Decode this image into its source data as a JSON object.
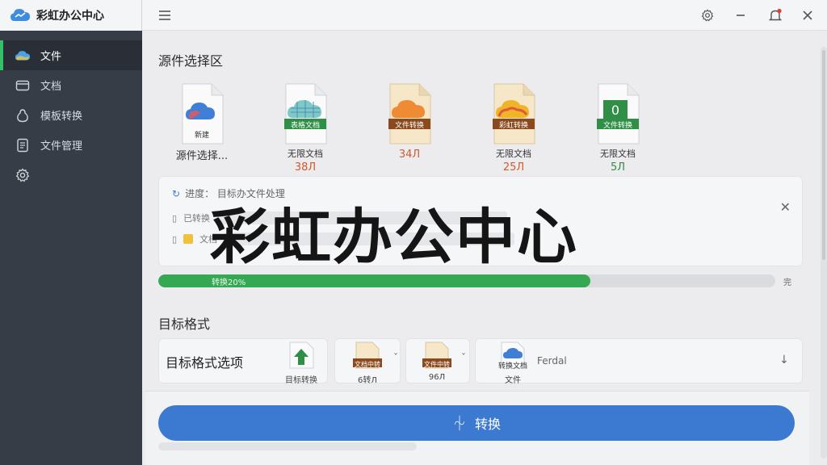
{
  "app": {
    "title": "彩虹办公中心",
    "overlay_title": "彩虹办公中心"
  },
  "sidebar": {
    "items": [
      {
        "label": "文件",
        "icon": "cloud-icon",
        "active": true
      },
      {
        "label": "文档",
        "icon": "folder-icon",
        "active": false
      },
      {
        "label": "模板转换",
        "icon": "pear-icon",
        "active": false
      },
      {
        "label": "文件管理",
        "icon": "document-icon",
        "active": false
      },
      {
        "label": "",
        "icon": "gear-icon",
        "active": false
      }
    ]
  },
  "source": {
    "title": "源件选择区",
    "files": [
      {
        "badge": "新建",
        "caption": "源件选择...",
        "size": "",
        "kind": "cloud"
      },
      {
        "badge": "表格文档",
        "caption": "无限文档",
        "size": "38Л",
        "kind": "sheet"
      },
      {
        "badge": "文件转换",
        "caption": "",
        "size": "34Л",
        "kind": "orange"
      },
      {
        "badge": "彩虹转换",
        "caption": "无限文档",
        "size": "25Л",
        "kind": "rainbow"
      },
      {
        "badge": "文件转换",
        "caption": "无限文档",
        "size": "5Л",
        "kind": "excel"
      }
    ]
  },
  "task": {
    "header": "进度： 目标办文件处理",
    "row1": "已转换",
    "row2": "文档"
  },
  "progress": {
    "label": "转换20%",
    "end": "完",
    "percent": 70
  },
  "target": {
    "title": "目标格式",
    "option_label": "目标格式选项",
    "items": [
      {
        "caption": "目标转换",
        "kind": "green-arrow"
      },
      {
        "badge": "文档中转",
        "caption": "6转Л",
        "kind": "doc"
      },
      {
        "badge": "文件中转",
        "caption": "96Л",
        "kind": "doc"
      },
      {
        "badge": "转换文档",
        "caption": "文件",
        "kind": "cloud"
      }
    ],
    "dropdown_label": "Ferdal"
  },
  "convert": {
    "label": "转换"
  },
  "colors": {
    "accent": "#34c06a",
    "primary": "#3c7ad1",
    "sidebar": "#373d47"
  }
}
